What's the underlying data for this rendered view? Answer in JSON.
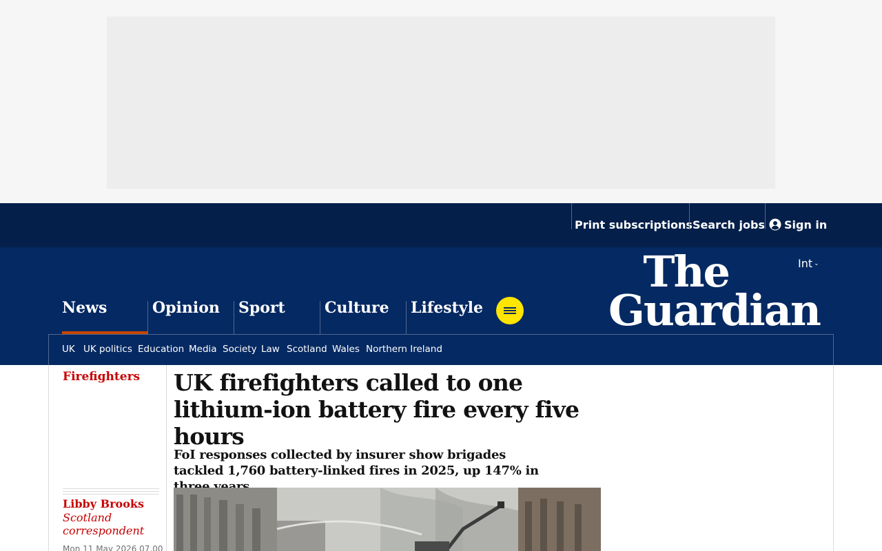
{
  "utility": {
    "print": "Print subscriptions",
    "jobs": "Search jobs",
    "signin": "Sign in"
  },
  "edition": "Int",
  "logo": {
    "line1": "The",
    "line2": "Guardian"
  },
  "pillars": [
    "News",
    "Opinion",
    "Sport",
    "Culture",
    "Lifestyle"
  ],
  "subnav": [
    "UK",
    "UK politics",
    "Education",
    "Media",
    "Society",
    "Law",
    "Scotland",
    "Wales",
    "Northern Ireland"
  ],
  "article": {
    "section": "Firefighters",
    "headline": "UK firefighters called to one lithium-ion battery fire every five hours",
    "standfirst": "FoI responses collected by insurer show brigades tackled 1,760 battery-linked fires in 2025, up 147% in three years",
    "author": "Libby Brooks",
    "role": "Scotland correspondent",
    "date": "Mon 11 May 2026 07.00"
  },
  "colors": {
    "brand": "#052962",
    "topbar": "#041f4a",
    "news_accent": "#c70000",
    "menu_button": "#ffe500"
  }
}
